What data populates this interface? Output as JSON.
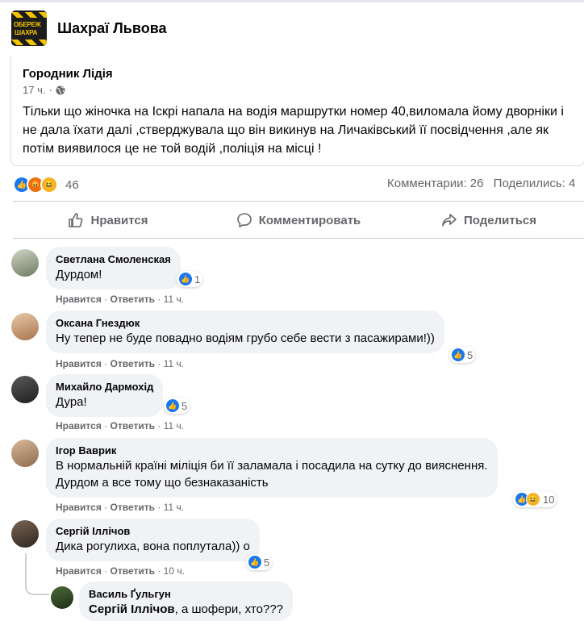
{
  "group": {
    "name": "Шахраї Львова",
    "logo_text_top": "ОБЕРЕЖ",
    "logo_text_bottom": "ШАХРА"
  },
  "post": {
    "author": "Городник Лідія",
    "time": "17 ч.",
    "separator": "·",
    "privacy_icon": "globe-icon",
    "text": "Тільки що жіночка на Іскрі напала на водія маршрутки номер 40,виломала йому дворніки і не дала їхати далі ,стверджувала що він викинув на Личаківський її посвідчення ,але як потім виявилося це не той водій ,поліція на місці !"
  },
  "reactions": {
    "icons": [
      "like",
      "angry",
      "haha"
    ],
    "count": "46",
    "colors": {
      "like": "#1877f2",
      "angry": "#e9710f",
      "haha": "#f7b125"
    }
  },
  "stats": {
    "comments": "Комментарии: 26",
    "shares": "Поделились: 4"
  },
  "actions": {
    "like": "Нравится",
    "comment": "Комментировать",
    "share": "Поделиться"
  },
  "comment_actions": {
    "like": "Нравится",
    "reply": "Ответить",
    "dot": "·"
  },
  "comments": [
    {
      "name": "Светлана Смоленская",
      "text": "Дурдом!",
      "time": "11 ч.",
      "reactions": "1"
    },
    {
      "name": "Оксана Гнездюк",
      "text": "Ну тепер не буде повадно водіям грубо себе вести з пасажирами!))",
      "time": "11 ч.",
      "reactions": "5"
    },
    {
      "name": "Михайло Дармохід",
      "text": "Дура!",
      "time": "11 ч.",
      "reactions": "5"
    },
    {
      "name": "Ігор Ваврик",
      "text_line1": "В нормальній країні міліція би її заламала і посадила на сутку до вияснення.",
      "text_line2": "Дурдом а все тому що безнаказаність",
      "time": "11 ч.",
      "reactions": "10"
    },
    {
      "name": "Сергій Іллічов",
      "text": "Дика рогулиха, вона поплутала)) о",
      "time": "10 ч.",
      "reactions": "5"
    }
  ],
  "reply": {
    "name": "Василь Ґульгун",
    "mention": "Сергій Іллічов",
    "text": ", а шофери, хто???"
  }
}
